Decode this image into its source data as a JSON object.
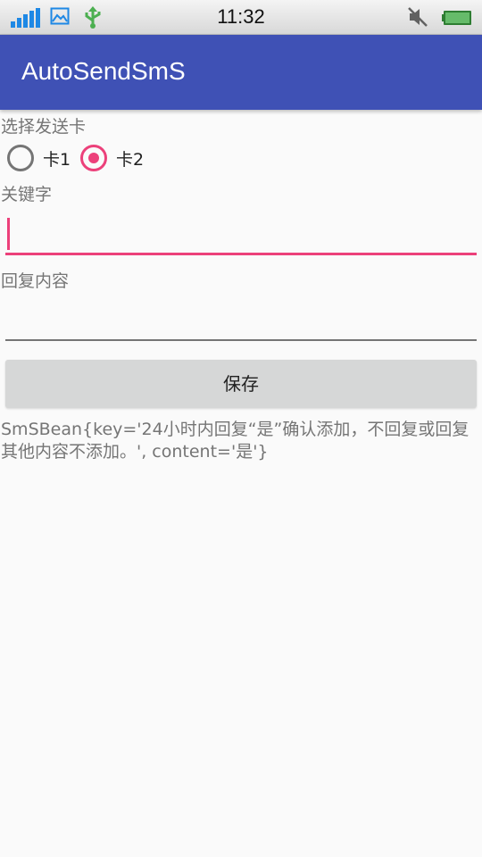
{
  "status_bar": {
    "time": "11:32",
    "icons": [
      "signal-icon",
      "image-icon",
      "usb-icon",
      "mute-icon",
      "battery-icon"
    ],
    "colors": {
      "signal": "#1e88e5",
      "usb": "#4caf50",
      "battery": "#43a047"
    }
  },
  "app_bar": {
    "title": "AutoSendSmS",
    "color": "#3f51b5"
  },
  "form": {
    "card_label": "选择发送卡",
    "radios": [
      {
        "label": "卡1",
        "checked": false
      },
      {
        "label": "卡2",
        "checked": true
      }
    ],
    "keyword_label": "关键字",
    "keyword_value": "",
    "reply_label": "回复内容",
    "reply_value": "",
    "save_label": "保存",
    "accent_color": "#ec407a"
  },
  "result": {
    "text": "SmSBean{key='24小时内回复“是”确认添加，不回复或回复其他内容不添加。', content='是'}"
  }
}
